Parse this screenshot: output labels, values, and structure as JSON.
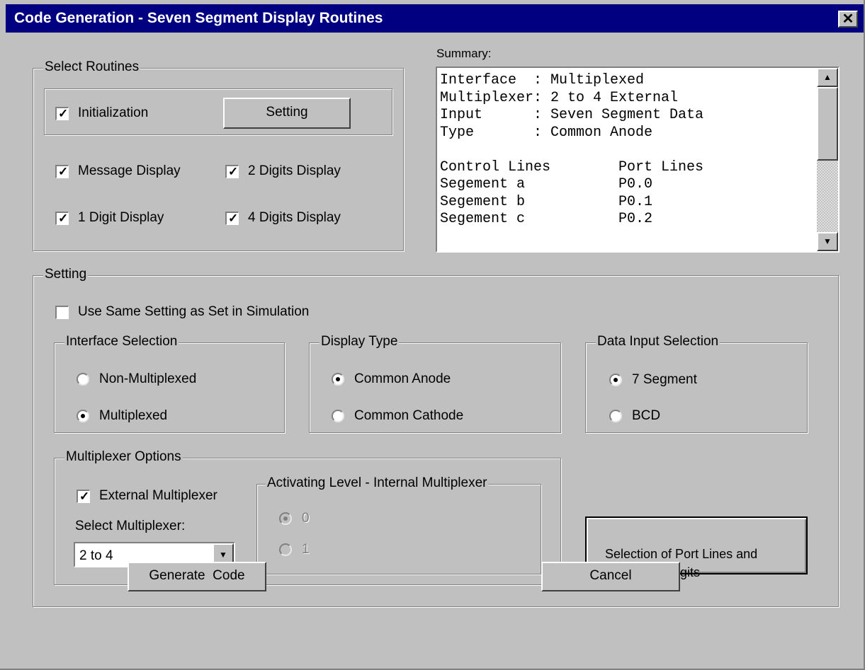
{
  "window": {
    "title": "Code Generation - Seven Segment Display Routines",
    "close_glyph": "✕"
  },
  "select_routines": {
    "legend": "Select Routines",
    "initialization": {
      "label": "Initialization",
      "checked": true
    },
    "setting_button": "Setting",
    "message_display": {
      "label": "Message Display",
      "checked": true
    },
    "two_digits": {
      "label": "2 Digits Display",
      "checked": true
    },
    "one_digit": {
      "label": "1 Digit Display",
      "checked": true
    },
    "four_digits": {
      "label": "4 Digits Display",
      "checked": true
    }
  },
  "summary": {
    "label": "Summary:",
    "lines": [
      "Interface  : Multiplexed",
      "Multiplexer: 2 to 4 External",
      "Input      : Seven Segment Data",
      "Type       : Common Anode",
      "",
      "Control Lines        Port Lines",
      "Segement a           P0.0",
      "Segement b           P0.1",
      "Segement c           P0.2"
    ],
    "scroll_up_glyph": "▲",
    "scroll_down_glyph": "▼"
  },
  "setting": {
    "legend": "Setting",
    "use_same": {
      "label": "Use Same Setting as Set in Simulation",
      "checked": false
    },
    "interface": {
      "legend": "Interface Selection",
      "non_multiplexed": {
        "label": "Non-Multiplexed",
        "selected": false
      },
      "multiplexed": {
        "label": "Multiplexed",
        "selected": true
      }
    },
    "display_type": {
      "legend": "Display Type",
      "common_anode": {
        "label": "Common Anode",
        "selected": true
      },
      "common_cathode": {
        "label": "Common Cathode",
        "selected": false
      }
    },
    "data_input": {
      "legend": "Data Input Selection",
      "seven_segment": {
        "label": "7 Segment",
        "selected": true
      },
      "bcd": {
        "label": "BCD",
        "selected": false
      }
    },
    "multiplexer_options": {
      "legend": "Multiplexer Options",
      "external": {
        "label": "External Multiplexer",
        "checked": true
      },
      "select_label": "Select Multiplexer:",
      "select_value": "2 to 4",
      "select_arrow_glyph": "▼",
      "activating": {
        "legend": "Activating Level - Internal Multiplexer",
        "zero": {
          "label": "0",
          "selected": true,
          "enabled": false
        },
        "one": {
          "label": "1",
          "selected": false,
          "enabled": false
        }
      }
    },
    "port_lines_button": "Selection of Port Lines and\nNumber  of Digits"
  },
  "footer": {
    "generate": "Generate  Code",
    "cancel": "Cancel"
  },
  "check_glyph": "✓"
}
